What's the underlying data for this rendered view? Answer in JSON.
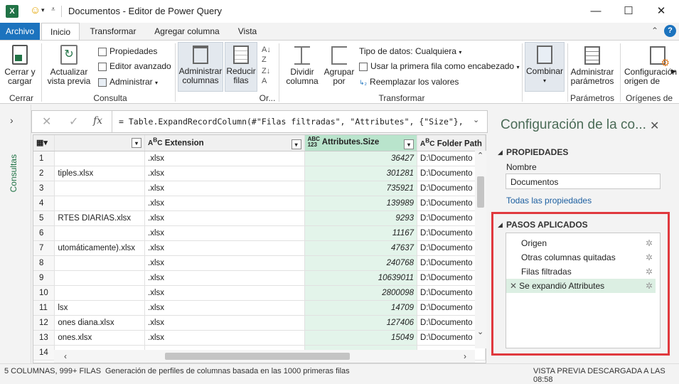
{
  "window": {
    "title": "Documentos - Editor de Power Query",
    "minimize": "—",
    "maximize": "☐",
    "close": "✕"
  },
  "tabs": [
    "Archivo",
    "Inicio",
    "Transformar",
    "Agregar columna",
    "Vista"
  ],
  "ribbon": {
    "close_load": "Cerrar y\ncargar",
    "refresh": "Actualizar\nvista previa",
    "properties": "Propiedades",
    "advanced_editor": "Editor avanzado",
    "manage": "Administrar",
    "group_close": "Cerrar",
    "group_query": "Consulta",
    "manage_columns": "Administrar\ncolumnas",
    "reduce_rows": "Reducir\nfilas",
    "group_sort_abbrev": "Or...",
    "split_column": "Dividir\ncolumna",
    "group_by": "Agrupar\npor",
    "data_type": "Tipo de datos: Cualquiera",
    "first_row_header": "Usar la primera fila como encabezado",
    "replace_values": "Reemplazar los valores",
    "group_transform": "Transformar",
    "combine": "Combinar",
    "manage_params": "Administrar\nparámetros",
    "group_params": "Parámetros",
    "config_source": "Configuración\norigen de",
    "group_sources": "Orígenes de"
  },
  "leftnav": {
    "label": "Consultas"
  },
  "formula": {
    "text": "= Table.ExpandRecordColumn(#\"Filas filtradas\", \"Attributes\", {\"Size\"},"
  },
  "grid": {
    "columns": [
      "",
      "Extension",
      "Attributes.Size",
      "Folder Path"
    ],
    "rows": [
      {
        "n": "1",
        "name": "",
        "ext": ".xlsx",
        "size": "36427",
        "path": "D:\\Documento"
      },
      {
        "n": "2",
        "name": "tiples.xlsx",
        "ext": ".xlsx",
        "size": "301281",
        "path": "D:\\Documento"
      },
      {
        "n": "3",
        "name": "",
        "ext": ".xlsx",
        "size": "735921",
        "path": "D:\\Documento"
      },
      {
        "n": "4",
        "name": "",
        "ext": ".xlsx",
        "size": "139989",
        "path": "D:\\Documento"
      },
      {
        "n": "5",
        "name": "RTES DIARIAS.xlsx",
        "ext": ".xlsx",
        "size": "9293",
        "path": "D:\\Documento"
      },
      {
        "n": "6",
        "name": "",
        "ext": ".xlsx",
        "size": "11167",
        "path": "D:\\Documento"
      },
      {
        "n": "7",
        "name": "utomáticamente).xlsx",
        "ext": ".xlsx",
        "size": "47637",
        "path": "D:\\Documento"
      },
      {
        "n": "8",
        "name": "",
        "ext": ".xlsx",
        "size": "240768",
        "path": "D:\\Documento"
      },
      {
        "n": "9",
        "name": "",
        "ext": ".xlsx",
        "size": "10639011",
        "path": "D:\\Documento"
      },
      {
        "n": "10",
        "name": "",
        "ext": ".xlsx",
        "size": "2800098",
        "path": "D:\\Documento"
      },
      {
        "n": "11",
        "name": "lsx",
        "ext": ".xlsx",
        "size": "14709",
        "path": "D:\\Documento"
      },
      {
        "n": "12",
        "name": "ones diana.xlsx",
        "ext": ".xlsx",
        "size": "127406",
        "path": "D:\\Documento"
      },
      {
        "n": "13",
        "name": "ones.xlsx",
        "ext": ".xlsx",
        "size": "15049",
        "path": "D:\\Documento"
      },
      {
        "n": "14",
        "name": "",
        "ext": "",
        "size": "",
        "path": ""
      }
    ]
  },
  "panel": {
    "title": "Configuración de la co...",
    "props_header": "PROPIEDADES",
    "name_label": "Nombre",
    "name_value": "Documentos",
    "all_props": "Todas las propiedades",
    "steps_header": "PASOS APLICADOS",
    "steps": [
      "Origen",
      "Otras columnas quitadas",
      "Filas filtradas",
      "Se expandió Attributes"
    ]
  },
  "status": {
    "left": "5 COLUMNAS, 999+ FILAS",
    "middle": "Generación de perfiles de columnas basada en las 1000 primeras filas",
    "right": "VISTA PREVIA DESCARGADA A LAS 08:58"
  },
  "colors": {
    "accent": "#1c73be",
    "selected_col": "#b9e4cc",
    "highlight_box": "#e0393e",
    "green": "#217346"
  }
}
